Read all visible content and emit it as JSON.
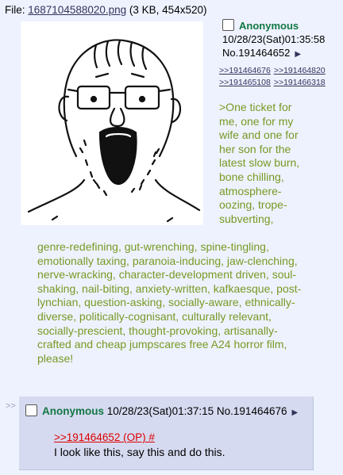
{
  "file": {
    "prefix": "File: ",
    "name": "1687104588020.png",
    "info": " (3 KB, 454x520)"
  },
  "op": {
    "name": "Anonymous",
    "datetime": "10/28/23(Sat)01:35:58",
    "number": "No.191464652",
    "backlinks": [
      ">>191464676",
      ">>191464820",
      ">>191465108",
      ">>191466318"
    ],
    "greentext_right": ">One ticket for me, one for my wife and one for her son for the latest slow burn, bone chilling, atmosphere-oozing, trope-subverting,",
    "greentext_bottom": "genre-redefining, gut-wrenching, spine-tingling, emotionally taxing, paranoia-inducing, jaw-clenching, nerve-wracking, character-development driven, soul-shaking, nail-biting, anxiety-written, kafkaesque, post-lynchian, question-asking, socially-aware, ethnically-diverse, politically-cognisant, culturally relevant, socially-prescient, thought-provoking, artisanally-crafted and cheap jumpscares free A24 horror film, please!"
  },
  "reply": {
    "side_marker": ">>",
    "name": "Anonymous",
    "datetime": "10/28/23(Sat)01:37:15",
    "number": "No.191464676",
    "quote": ">>191464652 (OP) #",
    "text": "I look like this, say this and do this."
  },
  "colors": {
    "background": "#eef2ff",
    "reply_bg": "#d6daf0",
    "name": "#117743",
    "greentext": "#789922",
    "link": "#34345c",
    "quotelink": "#dd0000"
  }
}
